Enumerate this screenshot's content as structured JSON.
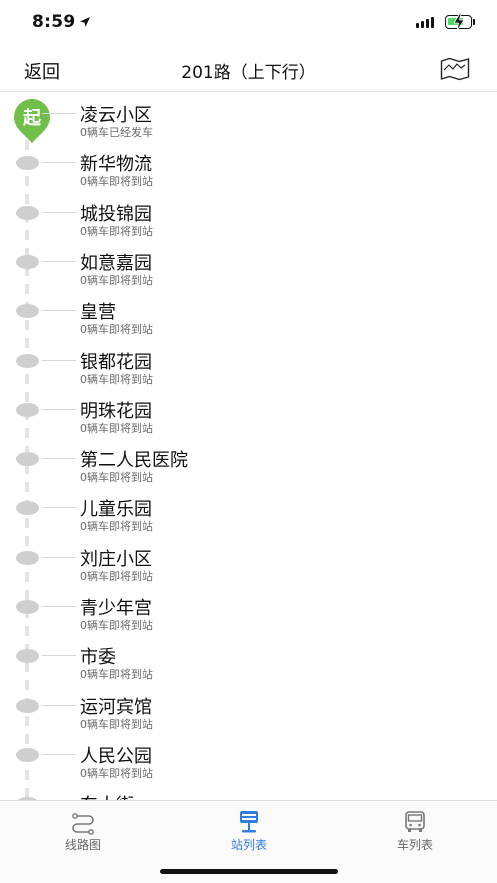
{
  "status_bar": {
    "time": "8:59"
  },
  "nav": {
    "back_label": "返回",
    "title": "201路（上下行）"
  },
  "start_badge": "起",
  "stations": [
    {
      "name": "凌云小区",
      "status": "0辆车已经发车"
    },
    {
      "name": "新华物流",
      "status": "0辆车即将到站"
    },
    {
      "name": "城投锦园",
      "status": "0辆车即将到站"
    },
    {
      "name": "如意嘉园",
      "status": "0辆车即将到站"
    },
    {
      "name": "皇营",
      "status": "0辆车即将到站"
    },
    {
      "name": "银都花园",
      "status": "0辆车即将到站"
    },
    {
      "name": "明珠花园",
      "status": "0辆车即将到站"
    },
    {
      "name": "第二人民医院",
      "status": "0辆车即将到站"
    },
    {
      "name": "儿童乐园",
      "status": "0辆车即将到站"
    },
    {
      "name": "刘庄小区",
      "status": "0辆车即将到站"
    },
    {
      "name": "青少年宫",
      "status": "0辆车即将到站"
    },
    {
      "name": "市委",
      "status": "0辆车即将到站"
    },
    {
      "name": "运河宾馆",
      "status": "0辆车即将到站"
    },
    {
      "name": "人民公园",
      "status": "0辆车即将到站"
    },
    {
      "name": "东大街",
      "status": ""
    }
  ],
  "tabs": [
    {
      "label": "线路图",
      "icon": "route-map-icon",
      "active": false
    },
    {
      "label": "站列表",
      "icon": "station-list-icon",
      "active": true
    },
    {
      "label": "车列表",
      "icon": "bus-icon",
      "active": false
    }
  ],
  "colors": {
    "accent": "#2f7de1",
    "start_green": "#6fbf4a",
    "dot_gray": "#cfcfcf"
  }
}
